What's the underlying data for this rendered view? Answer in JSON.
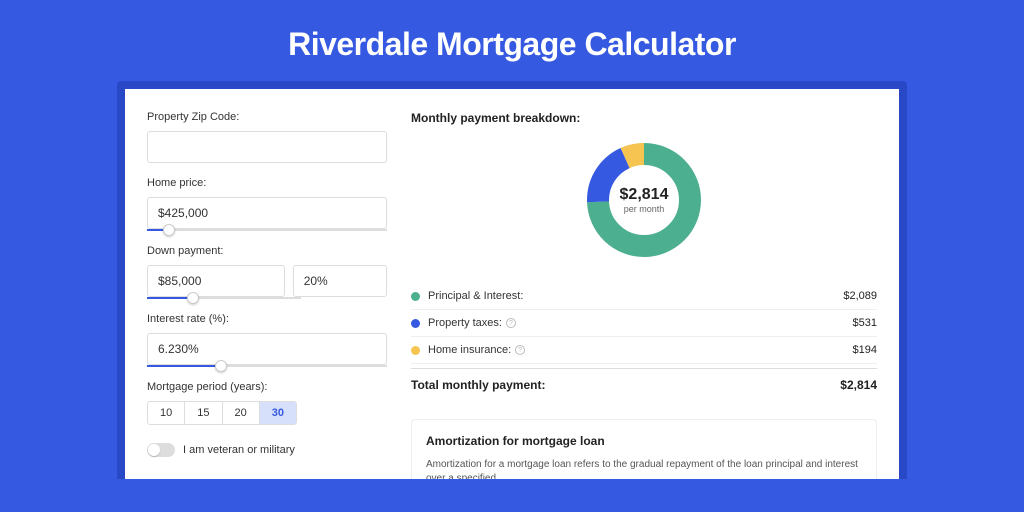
{
  "title": "Riverdale Mortgage Calculator",
  "form": {
    "zip_label": "Property Zip Code:",
    "zip_value": "",
    "home_price_label": "Home price:",
    "home_price_value": "$425,000",
    "down_payment_label": "Down payment:",
    "down_payment_amount": "$85,000",
    "down_payment_pct": "20%",
    "interest_label": "Interest rate (%):",
    "interest_value": "6.230%",
    "period_label": "Mortgage period (years):",
    "periods": [
      "10",
      "15",
      "20",
      "30"
    ],
    "period_selected": "30",
    "veteran_label": "I am veteran or military"
  },
  "breakdown": {
    "heading": "Monthly payment breakdown:",
    "center_amount": "$2,814",
    "center_sub": "per month",
    "items": [
      {
        "label": "Principal & Interest:",
        "value": "$2,089",
        "color": "green"
      },
      {
        "label": "Property taxes:",
        "value": "$531",
        "color": "blue",
        "info": true
      },
      {
        "label": "Home insurance:",
        "value": "$194",
        "color": "yellow",
        "info": true
      }
    ],
    "total_label": "Total monthly payment:",
    "total_value": "$2,814"
  },
  "amortization": {
    "heading": "Amortization for mortgage loan",
    "text": "Amortization for a mortgage loan refers to the gradual repayment of the loan principal and interest over a specified"
  },
  "chart_data": {
    "type": "pie",
    "title": "Monthly payment breakdown",
    "series": [
      {
        "name": "Principal & Interest",
        "value": 2089,
        "color": "#4caf8f"
      },
      {
        "name": "Property taxes",
        "value": 531,
        "color": "#3559e0"
      },
      {
        "name": "Home insurance",
        "value": 194,
        "color": "#f5c451"
      }
    ],
    "total": 2814,
    "unit": "USD per month"
  }
}
